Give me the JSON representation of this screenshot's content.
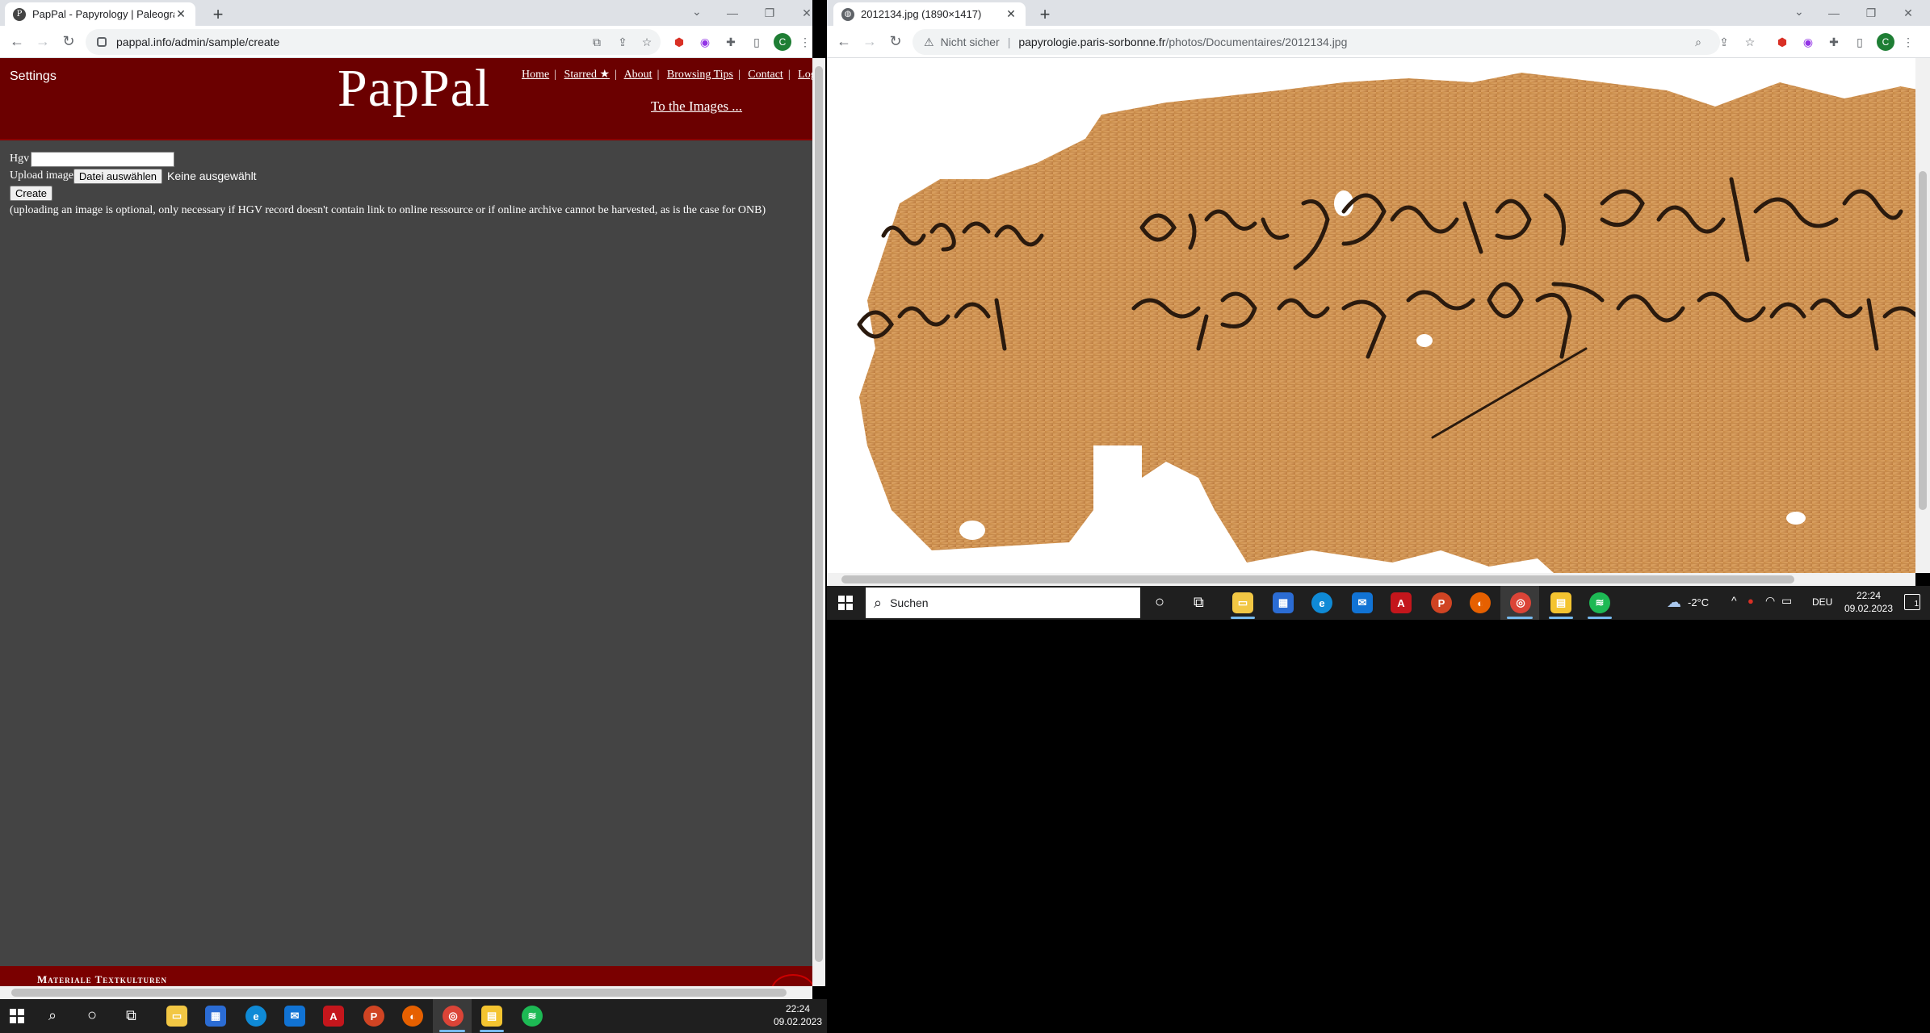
{
  "left_browser": {
    "tab_title": "PapPal - Papyrology | Paleograph",
    "tab_favicon": "P",
    "url": "pappal.info/admin/sample/create"
  },
  "right_browser": {
    "tab_title": "2012134.jpg (1890×1417)",
    "security_label": "Nicht sicher",
    "url_host": "papyrologie.paris-sorbonne.fr",
    "url_path": "/photos/Documentaires/2012134.jpg"
  },
  "profile_initial": "C",
  "pappal": {
    "settings": "Settings",
    "logo": "PapPal",
    "nav": [
      "Home",
      "Starred ★",
      "About",
      "Browsing Tips",
      "Contact",
      "Logout"
    ],
    "to_images": "To the Images ...",
    "form": {
      "hgv_label": "Hgv",
      "hgv_value": "",
      "upload_label": "Upload image",
      "file_button": "Datei auswählen",
      "file_status": "Keine ausgewählt",
      "create_button": "Create",
      "note": "(uploading an image is optional, only necessary if HGV record doesn't contain link to online ressource or if online archive cannot be harvested, as is the case for ONB)"
    },
    "footer": "Materiale Textkulturen"
  },
  "taskbar_left": {
    "time": "22:24",
    "date": "09.02.2023"
  },
  "taskbar_right": {
    "search_placeholder": "Suchen",
    "weather": "-2°C",
    "language": "DEU",
    "time": "22:24",
    "date": "09.02.2023",
    "notification_count": "1"
  }
}
